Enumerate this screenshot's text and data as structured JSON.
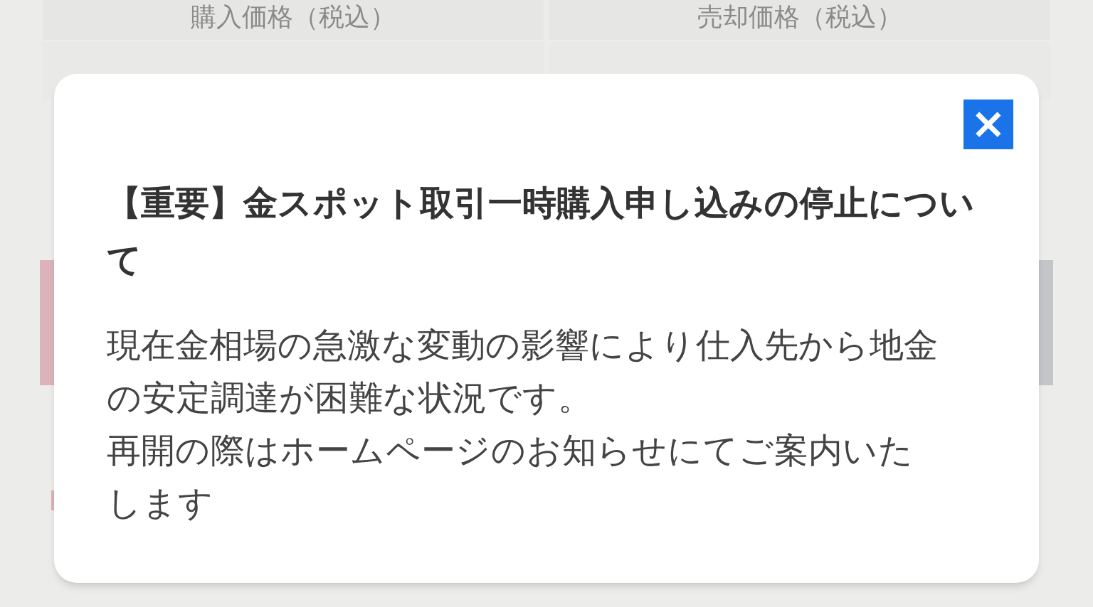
{
  "background": {
    "columns": [
      "購入価格（税込）",
      "売却価格（税込）"
    ]
  },
  "dialog": {
    "close": "×",
    "title": "【重要】金スポット取引一時購入申し込みの停止について",
    "paragraphs": [
      "現在金相場の急激な変動の影響により仕入先から地金の安定調達が困難な状況です。",
      "再開の際はホームページのお知らせにてご案内いたします"
    ]
  }
}
